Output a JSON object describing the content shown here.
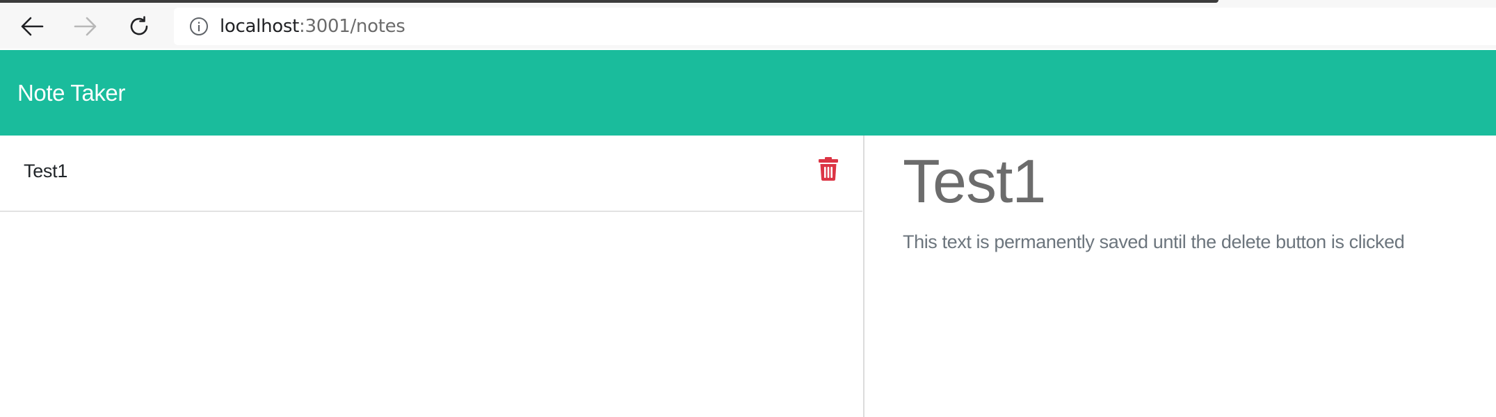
{
  "browser": {
    "url_host": "localhost",
    "url_rest": ":3001/notes",
    "icons": {
      "back": "arrow-left-icon",
      "forward": "arrow-right-icon",
      "reload": "reload-icon",
      "info": "info-circle-icon"
    }
  },
  "header": {
    "brand": "Note Taker",
    "background_color": "#1abc9c"
  },
  "notes": {
    "items": [
      {
        "title": "Test1",
        "delete_icon": "trash-icon",
        "delete_color": "#dc3545"
      }
    ]
  },
  "active_note": {
    "title": "Test1",
    "text": "This text is permanently saved until the delete button is clicked"
  }
}
